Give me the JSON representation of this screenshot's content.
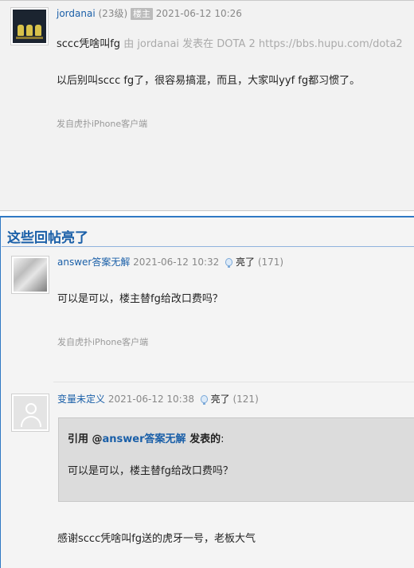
{
  "op": {
    "username": "jordanai",
    "level": "(23级)",
    "badge": "楼主",
    "time": "2021-06-12 10:26",
    "title": "sccc凭啥叫fg",
    "title_source": "由  jordanai 发表在 DOTA 2 https://bbs.hupu.com/dota2",
    "body": "以后别叫sccc fg了，很容易搞混，而且，大家叫yyf fg都习惯了。",
    "client": "发自虎扑iPhone客户端"
  },
  "lights": {
    "title": "这些回帖亮了",
    "replies": [
      {
        "username": "answer答案无解",
        "time": "2021-06-12 10:32",
        "light_label": "亮了",
        "light_count": "(171)",
        "body": "可以是可以，楼主替fg给改口费吗？",
        "client": "发自虎扑iPhone客户端"
      },
      {
        "username": "变量未定义",
        "time": "2021-06-12 10:38",
        "light_label": "亮了",
        "light_count": "(121)",
        "quote": {
          "prefix": "引用 @",
          "user": "answer答案无解",
          "suffix": " 发表的",
          "colon": ":",
          "text": "可以是可以，楼主替fg给改口费吗？"
        },
        "body": "感谢sccc凭啥叫fg送的虎牙一号，老板大气"
      }
    ]
  }
}
